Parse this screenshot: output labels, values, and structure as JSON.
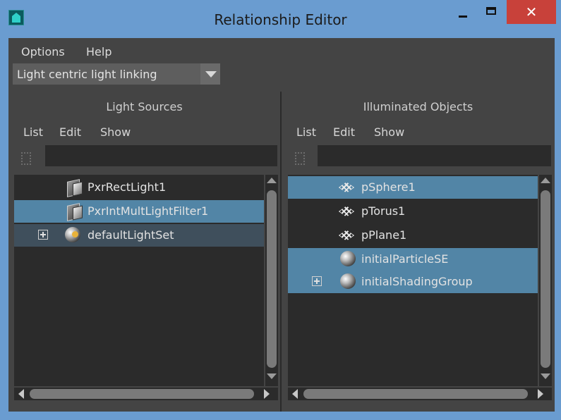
{
  "window": {
    "title": "Relationship Editor",
    "close_symbol": "✕"
  },
  "menubar": {
    "options": "Options",
    "help": "Help"
  },
  "mode": {
    "value": "Light centric light linking"
  },
  "left_panel": {
    "title": "Light Sources",
    "menus": [
      "List",
      "Edit",
      "Show"
    ],
    "search_value": "",
    "items": [
      {
        "label": "PxrRectLight1",
        "icon": "light-icon",
        "selected": false
      },
      {
        "label": "PxrIntMultLightFilter1",
        "icon": "light-icon",
        "selected": true
      },
      {
        "label": "defaultLightSet",
        "icon": "lightset-icon",
        "selected": false,
        "expandable": true
      }
    ]
  },
  "right_panel": {
    "title": "Illuminated Objects",
    "menus": [
      "List",
      "Edit",
      "Show"
    ],
    "search_value": "",
    "items": [
      {
        "label": "pSphere1",
        "icon": "mesh-icon",
        "selected": true
      },
      {
        "label": "pTorus1",
        "icon": "mesh-icon",
        "selected": false
      },
      {
        "label": "pPlane1",
        "icon": "mesh-icon",
        "selected": false
      },
      {
        "label": "initialParticleSE",
        "icon": "shading-group-icon",
        "selected": true
      },
      {
        "label": "initialShadingGroup",
        "icon": "shading-group-icon",
        "selected": true,
        "expandable": true
      }
    ]
  },
  "colors": {
    "selection": "#5285a6",
    "panel_bg": "#444444",
    "list_bg": "#2b2b2b",
    "title_bar": "#6a9cd0",
    "close": "#c8413a"
  }
}
